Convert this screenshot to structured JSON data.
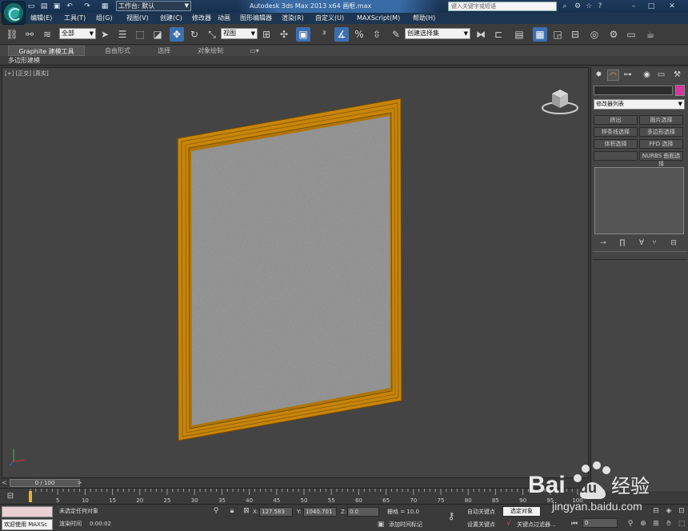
{
  "titlebar": {
    "workspace_label": "工作台: 默认",
    "window_title": "Autodesk 3ds Max  2013 x64     画框.max",
    "search_placeholder": "键入关键字或短语"
  },
  "menu": {
    "items": [
      "编辑(E)",
      "工具(T)",
      "组(G)",
      "视图(V)",
      "创建(C)",
      "修改器",
      "动画",
      "图形编辑器",
      "渲染(R)",
      "自定义(U)",
      "MAXScript(M)",
      "帮助(H)"
    ]
  },
  "toolbar": {
    "selection_filter": "全部",
    "reference_coord": "视图",
    "named_selection": "创建选择集"
  },
  "ribbon": {
    "tabs": [
      "Graphite 建模工具",
      "自由形式",
      "选择",
      "对象绘制"
    ],
    "sub_label": "多边形建模"
  },
  "viewport": {
    "label": "[+] [正交] [真实]",
    "frame_color": "#c8850a",
    "canvas_color": "#8a8a8a",
    "background_color": "#444444"
  },
  "command_panel": {
    "modifier_list": "修改器列表",
    "buttons": [
      "挤出",
      "面片选择",
      "样条线选择",
      "多边形选择",
      "体积选择",
      "FFD 选择",
      "NURBS 曲面选择"
    ],
    "swatch_color": "#d6379c"
  },
  "time_slider": {
    "position": "0 / 100"
  },
  "trackbar": {
    "ticks": [
      "0",
      "5",
      "10",
      "15",
      "20",
      "25",
      "30",
      "35",
      "40",
      "45",
      "50",
      "55",
      "60",
      "65",
      "70",
      "75",
      "80",
      "85",
      "90",
      "95",
      "100"
    ]
  },
  "status": {
    "welcome": "欢迎使用 MAXSc",
    "selection_status": "未选定任何对象",
    "render_time_label": "渲染时间",
    "render_time": "0:00:02",
    "x_label": "X:",
    "x_value": "127.583",
    "y_label": "Y:",
    "y_value": "1040.701",
    "z_label": "Z:",
    "z_value": "0.0",
    "grid": "栅格 = 10.0",
    "add_time_tag": "添加时间标记",
    "auto_key": "自动关键点",
    "selected_object": "选定对象",
    "set_key": "设置关键点",
    "key_filters": "关键点过滤器...",
    "frame_value": "0"
  },
  "watermark": {
    "brand": "Bai",
    "brand2": "du",
    "suffix": "经验",
    "url": "jingyan.baidu.com"
  }
}
